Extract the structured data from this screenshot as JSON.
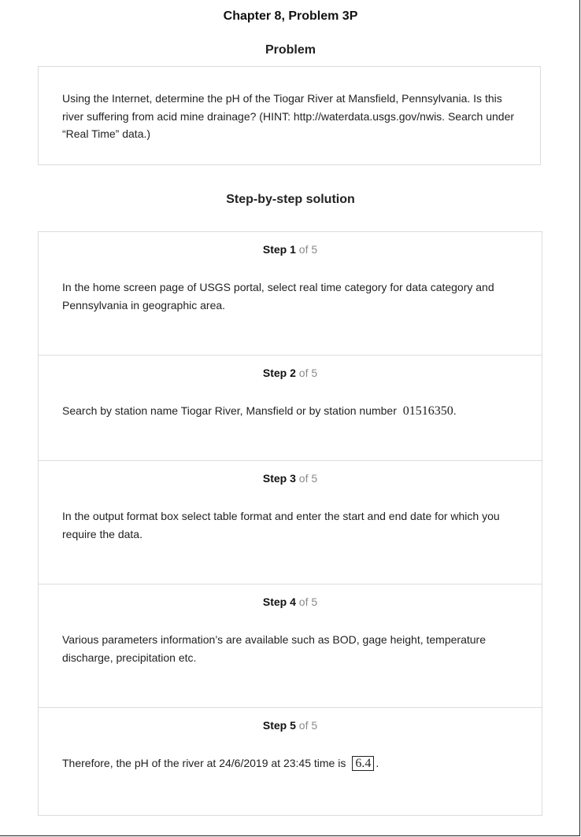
{
  "page": {
    "chapter_title": "Chapter 8, Problem 3P",
    "problem_heading": "Problem",
    "problem_text": "Using the Internet, determine the pH of the Tiogar River at Mansfield, Pennsylvania. Is this river suffering from acid mine drainage? (HINT: http://waterdata.usgs.gov/nwis. Search under “Real Time” data.)",
    "solution_heading": "Step-by-step solution"
  },
  "steps": [
    {
      "word": "Step",
      "number": "1",
      "of": "of 5",
      "text": "In the home screen page of USGS portal, select real time category for data category and Pennsylvania in geographic area."
    },
    {
      "word": "Step",
      "number": "2",
      "of": "of 5",
      "text": "Search by station name Tiogar River, Mansfield or by station number",
      "math": "01516350",
      "suffix": "."
    },
    {
      "word": "Step",
      "number": "3",
      "of": "of 5",
      "text": "In the output format box select table format and enter the start and end date for which you require the data."
    },
    {
      "word": "Step",
      "number": "4",
      "of": "of 5",
      "text": "Various parameters information’s are available such as BOD, gage height, temperature discharge, precipitation etc."
    },
    {
      "word": "Step",
      "number": "5",
      "of": "of 5",
      "text": "Therefore, the pH of the river at 24/6/2019 at 23:45 time is",
      "answer": "6.4",
      "suffix": "."
    }
  ],
  "colors": {
    "border": "#dcdcdc",
    "muted": "#8a8a8a",
    "text": "#222222"
  }
}
